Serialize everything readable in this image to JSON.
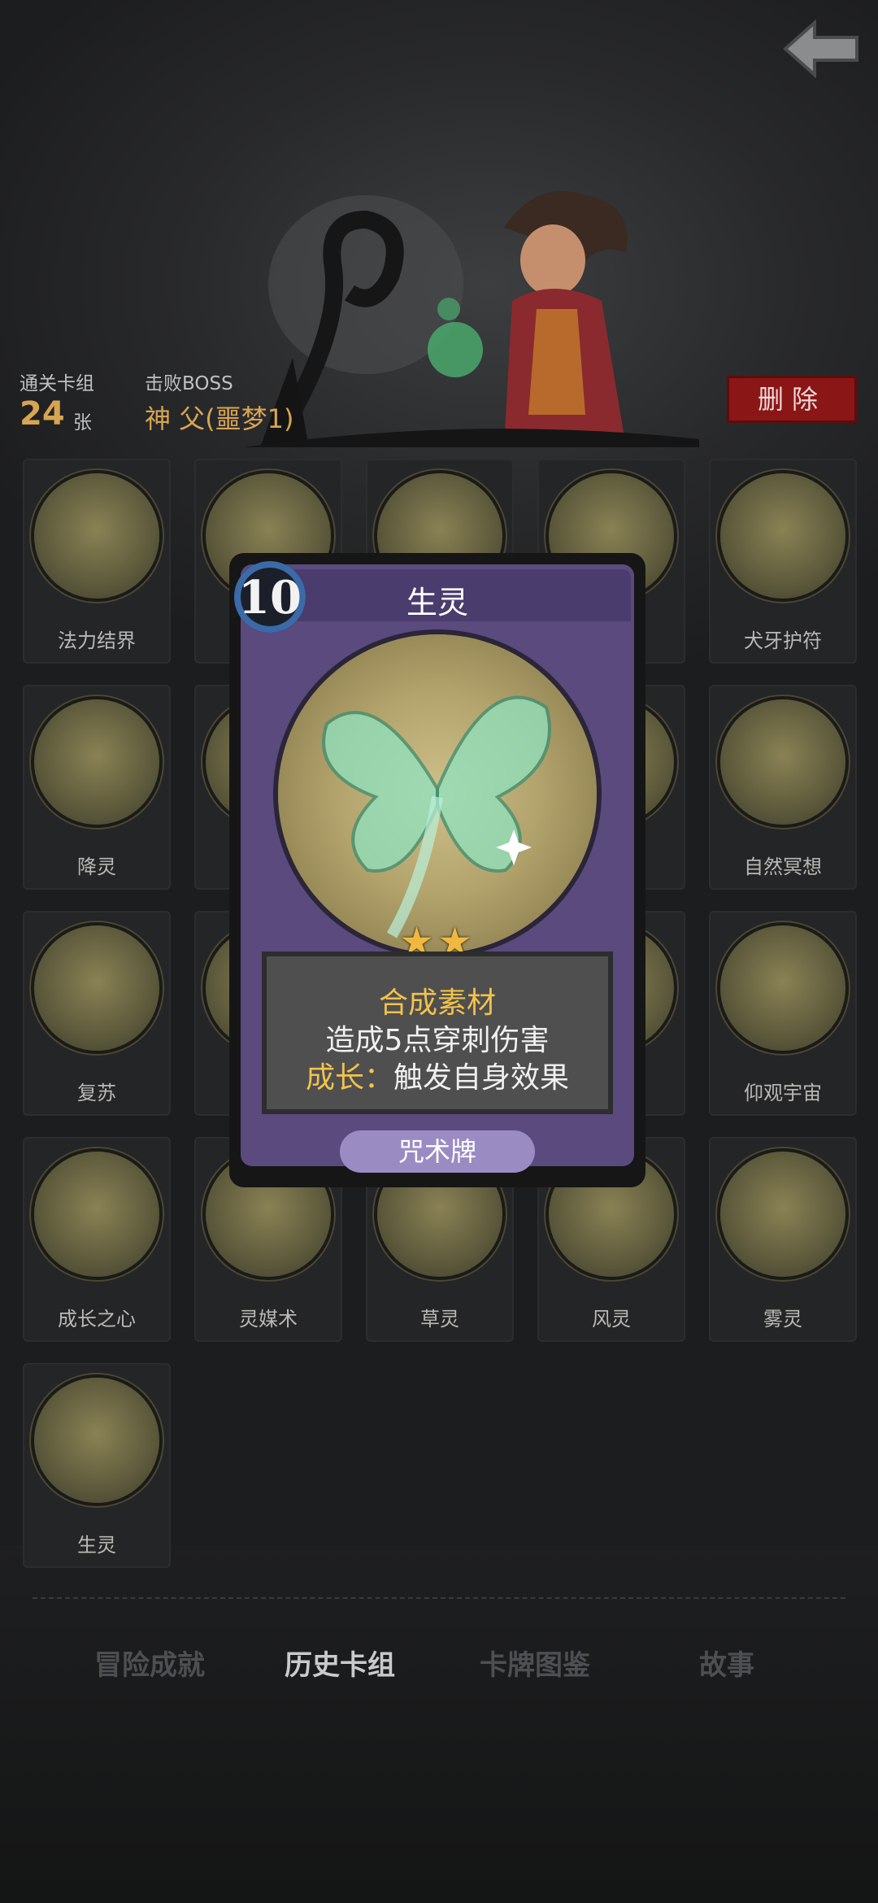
{
  "header": {
    "back_icon": "back-arrow-icon"
  },
  "stats": {
    "deck_label": "通关卡组",
    "deck_count": "24",
    "deck_unit": "张",
    "boss_label": "击败BOSS",
    "boss_name": "神 父(噩梦1)",
    "delete_label": "删除"
  },
  "cards": [
    {
      "name": "法力结界"
    },
    {
      "name": ""
    },
    {
      "name": ""
    },
    {
      "name": ""
    },
    {
      "name": "犬牙护符"
    },
    {
      "name": "降灵"
    },
    {
      "name": ""
    },
    {
      "name": ""
    },
    {
      "name": ""
    },
    {
      "name": "自然冥想"
    },
    {
      "name": "复苏"
    },
    {
      "name": ""
    },
    {
      "name": ""
    },
    {
      "name": ""
    },
    {
      "name": "仰观宇宙"
    },
    {
      "name": "成长之心"
    },
    {
      "name": "灵媒术"
    },
    {
      "name": "草灵"
    },
    {
      "name": "风灵"
    },
    {
      "name": "雾灵"
    },
    {
      "name": "生灵"
    }
  ],
  "modal": {
    "cost": "10",
    "title": "生灵",
    "stars": "★★",
    "line1": "合成素材",
    "line2": "造成5点穿刺伤害",
    "line3_key": "成长：",
    "line3_value": "触发自身效果",
    "type": "咒术牌"
  },
  "tabs": [
    {
      "label": "冒险成就"
    },
    {
      "label": "历史卡组"
    },
    {
      "label": "卡牌图鉴"
    },
    {
      "label": "故事"
    }
  ],
  "colors": {
    "accent_gold": "#d7a552",
    "delete_red": "#8b1616",
    "card_purple": "#5a4a7e"
  }
}
